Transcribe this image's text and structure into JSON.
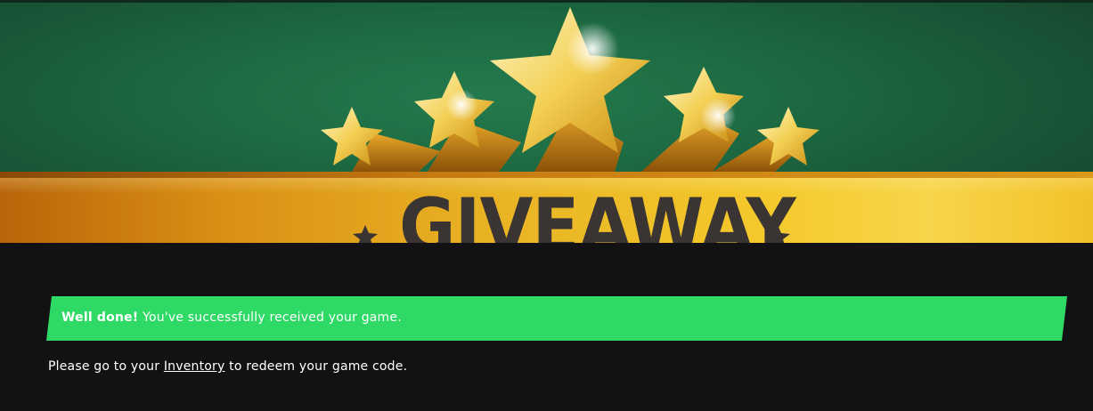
{
  "banner": {
    "title": "GIVEAWAY",
    "image_icon": "five-gold-stars-icon",
    "colors": {
      "green": "#1d6a42",
      "gold": "#f4c92c",
      "text": "#3a3533"
    }
  },
  "alert": {
    "strong": "Well done!",
    "message": "You've successfully received your game.",
    "color": "#2ed966"
  },
  "redeem": {
    "prefix": "Please go to your",
    "link": "Inventory",
    "suffix": "to redeem your game code."
  }
}
